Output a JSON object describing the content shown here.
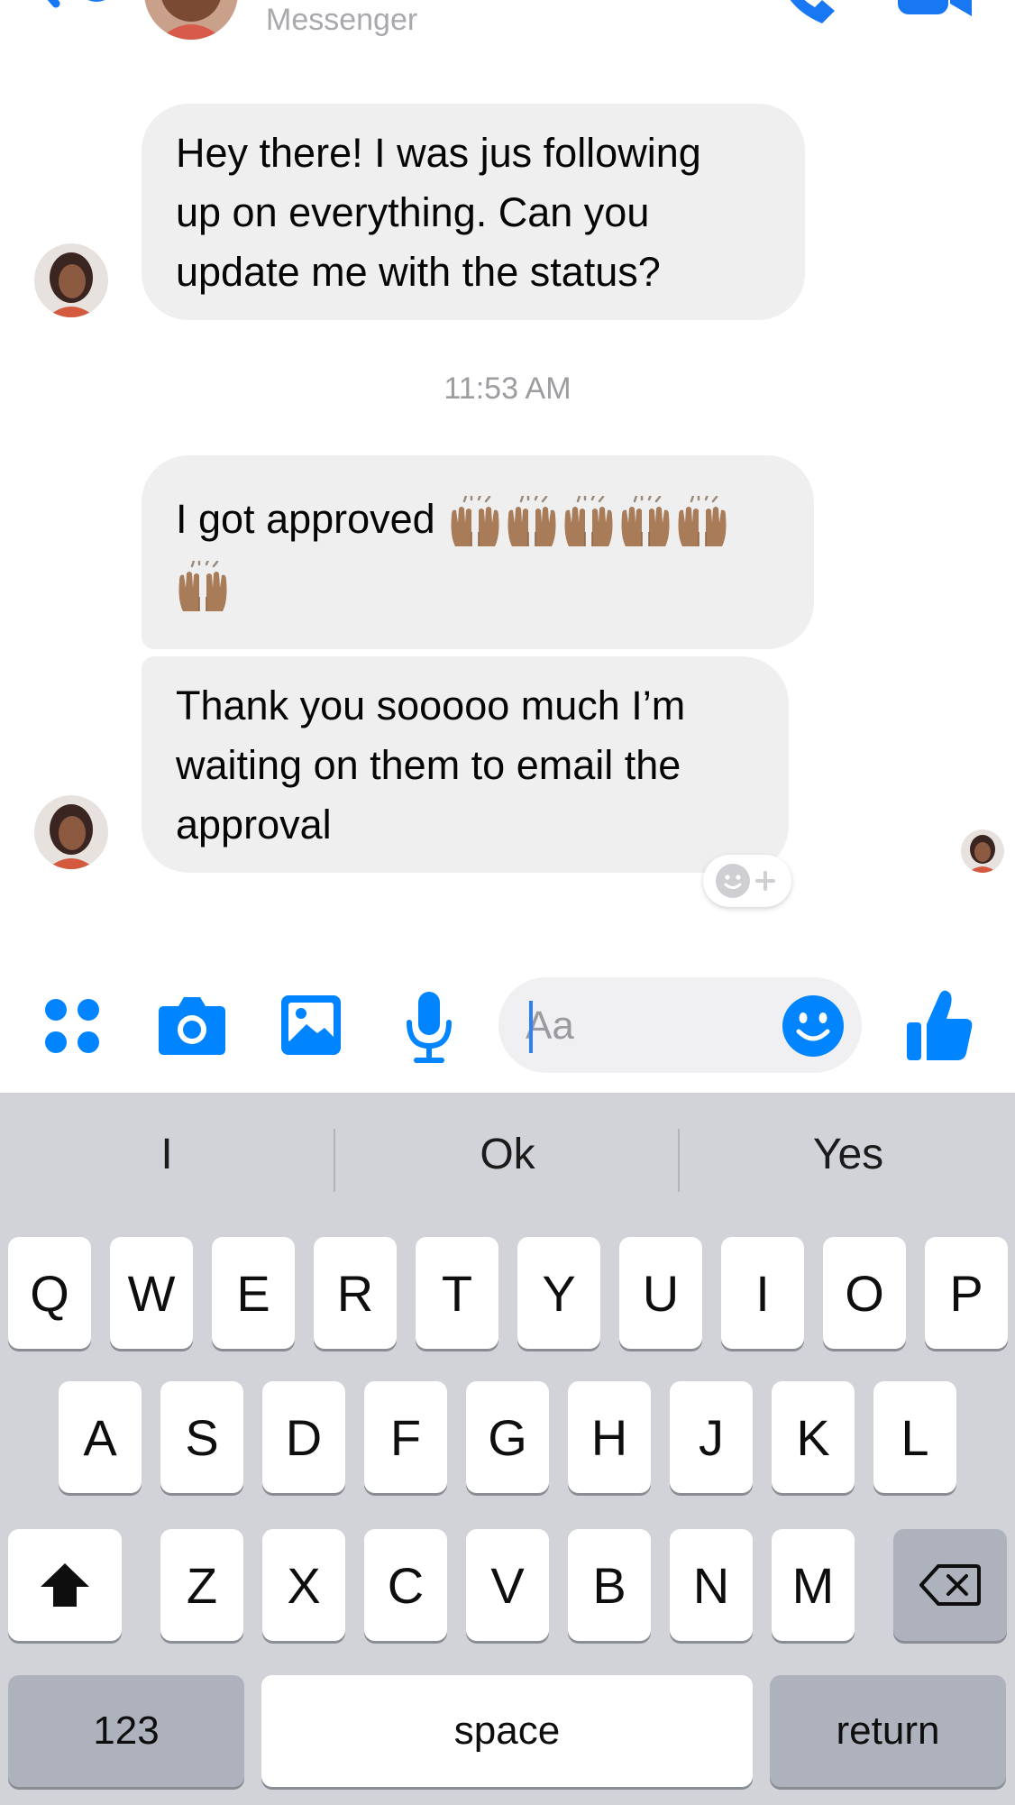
{
  "header": {
    "subtitle": "Messenger",
    "icons": [
      "back-arrow-icon",
      "phone-icon",
      "video-camera-icon"
    ]
  },
  "messages": [
    {
      "sender": "contact",
      "lines": [
        "Hey there! I was jus following",
        "up on everything. Can you",
        "update me with the status?"
      ]
    },
    {
      "sender": "contact",
      "text": "I got approved",
      "emoji": "raising-hands-medium-dark-skin",
      "emoji_count": 6
    },
    {
      "sender": "contact",
      "lines": [
        "Thank you sooooo much I’m",
        "waiting on them to email the",
        "approval"
      ]
    }
  ],
  "timestamp": "11:53 AM",
  "composer": {
    "placeholder": "Aa",
    "tools": [
      "apps-grid-icon",
      "camera-icon",
      "gallery-icon",
      "microphone-icon"
    ],
    "accent_color": "#0084ff"
  },
  "keyboard": {
    "suggestions": [
      "I",
      "Ok",
      "Yes"
    ],
    "row1": [
      "Q",
      "W",
      "E",
      "R",
      "T",
      "Y",
      "U",
      "I",
      "O",
      "P"
    ],
    "row2": [
      "A",
      "S",
      "D",
      "F",
      "G",
      "H",
      "J",
      "K",
      "L"
    ],
    "row3": [
      "Z",
      "X",
      "C",
      "V",
      "B",
      "N",
      "M"
    ],
    "numbers_label": "123",
    "space_label": "space",
    "return_label": "return"
  }
}
